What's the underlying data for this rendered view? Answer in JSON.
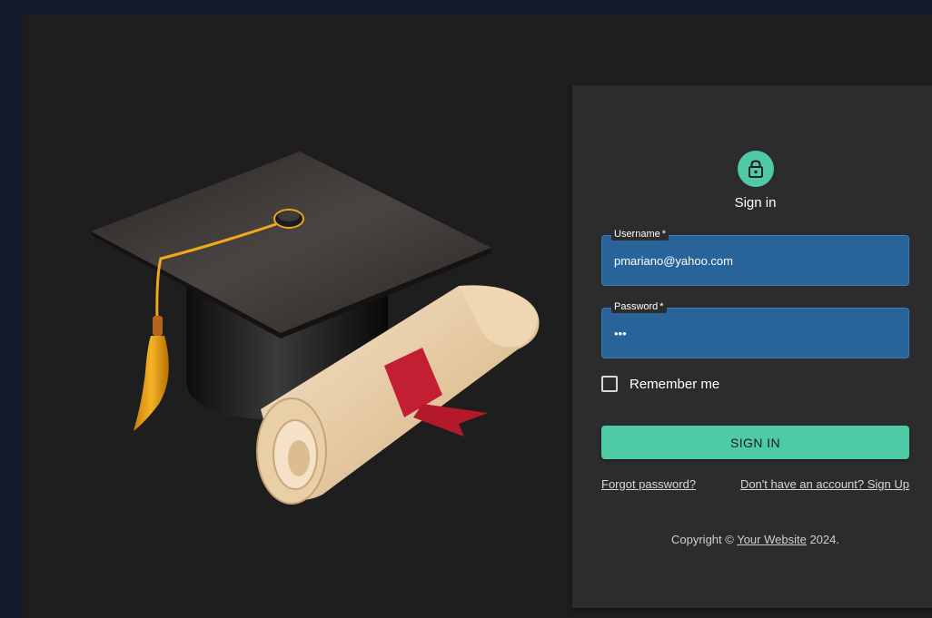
{
  "login": {
    "title": "Sign in",
    "username": {
      "label": "Username",
      "required_marker": "*",
      "value": "pmariano@yahoo.com"
    },
    "password": {
      "label": "Password",
      "required_marker": "*",
      "value": "•••"
    },
    "remember_label": "Remember me",
    "submit_label": "SIGN IN",
    "forgot_link": "Forgot password?",
    "signup_link": "Don't have an account? Sign Up",
    "copyright": {
      "prefix": "Copyright © ",
      "site": "Your Website",
      "suffix": " 2024."
    }
  },
  "icons": {
    "avatar": "lock-icon",
    "hero": "graduation-cap-diploma-illustration"
  },
  "colors": {
    "outer_background": "#141a2c",
    "panel_background": "#1e1e1e",
    "card_background": "#2c2c2c",
    "accent": "#4ecba6",
    "field_background": "#28649a"
  }
}
